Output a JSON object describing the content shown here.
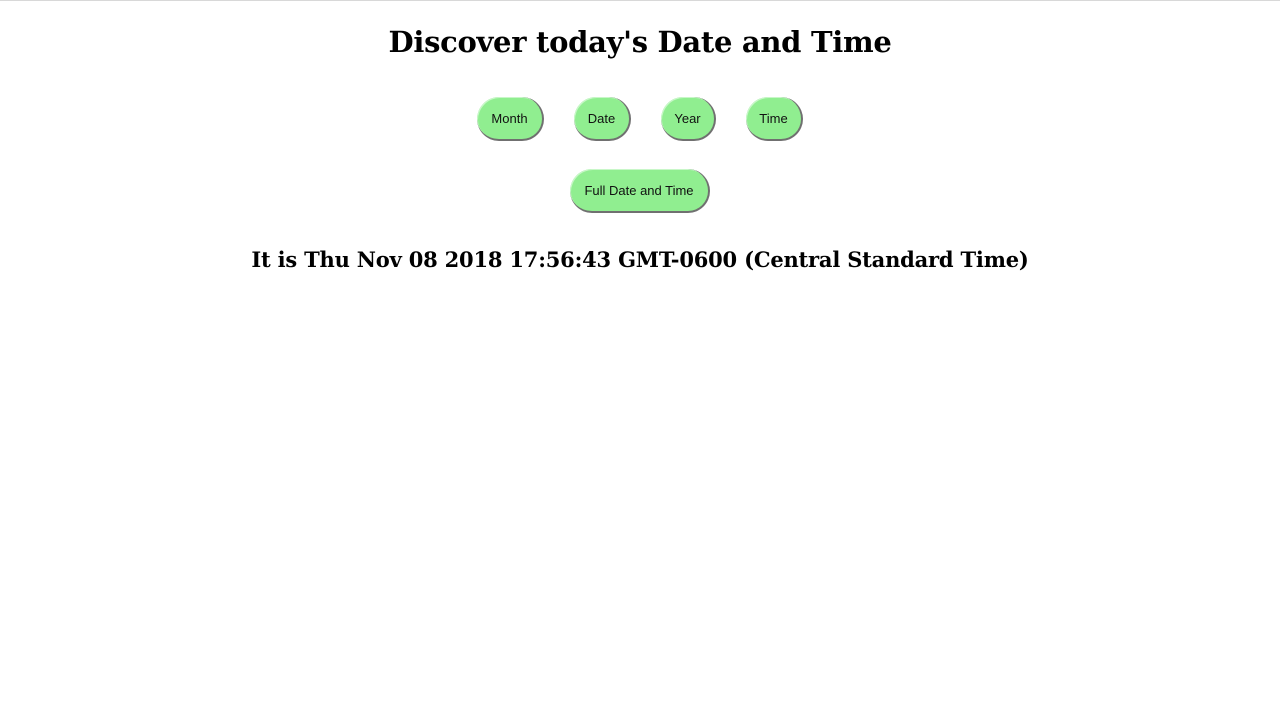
{
  "header": {
    "title": "Discover today's Date and Time"
  },
  "buttons": {
    "month": "Month",
    "date": "Date",
    "year": "Year",
    "time": "Time",
    "full": "Full Date and Time"
  },
  "result": {
    "text": "It is Thu Nov 08 2018 17:56:43 GMT-0600 (Central Standard Time)"
  },
  "colors": {
    "button_background": "#90ee90",
    "button_shadow": "#707070",
    "page_background": "#ffffff",
    "text": "#000000"
  }
}
